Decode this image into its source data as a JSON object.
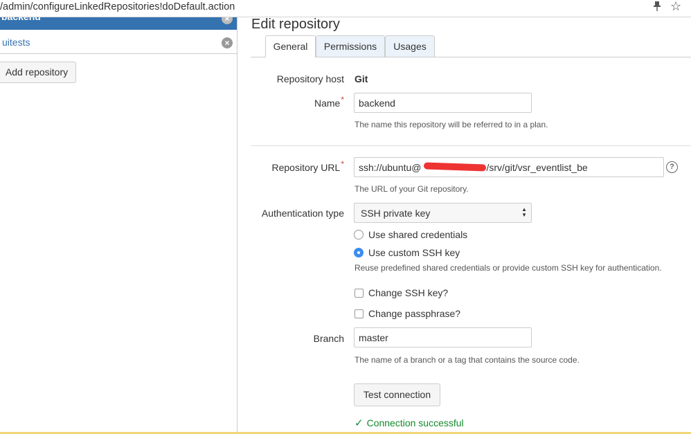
{
  "browser": {
    "url": "/admin/configureLinkedRepositories!doDefault.action",
    "icons": [
      "pin-icon",
      "star-icon"
    ]
  },
  "sidebar": {
    "items": [
      {
        "label": "backend",
        "selected": true
      },
      {
        "label": "uitests",
        "selected": false
      }
    ],
    "add_button": "Add repository"
  },
  "main": {
    "title": "Edit repository",
    "tabs": [
      {
        "label": "General",
        "active": true
      },
      {
        "label": "Permissions",
        "active": false
      },
      {
        "label": "Usages",
        "active": false
      }
    ],
    "repo_host_label": "Repository host",
    "repo_host_value": "Git",
    "name_label": "Name",
    "name_value": "backend",
    "name_desc": "The name this repository will be referred to in a plan.",
    "url_label": "Repository URL",
    "url_value_prefix": "ssh://ubuntu@",
    "url_value_suffix": "/srv/git/vsr_eventlist_be",
    "url_desc": "The URL of your Git repository.",
    "auth_label": "Authentication type",
    "auth_value": "SSH private key",
    "auth_options": [
      {
        "label": "Use shared credentials",
        "checked": false
      },
      {
        "label": "Use custom SSH key",
        "checked": true
      }
    ],
    "auth_desc": "Reuse predefined shared credentials or provide custom SSH key for authentication.",
    "change_ssh_key": "Change SSH key?",
    "change_passphrase": "Change passphrase?",
    "branch_label": "Branch",
    "branch_value": "master",
    "branch_desc": "The name of a branch or a tag that contains the source code.",
    "test_button": "Test connection",
    "success_text": "Connection successful"
  },
  "colors": {
    "accent": "#3572b0",
    "success": "#14892c",
    "required": "#d04437"
  }
}
